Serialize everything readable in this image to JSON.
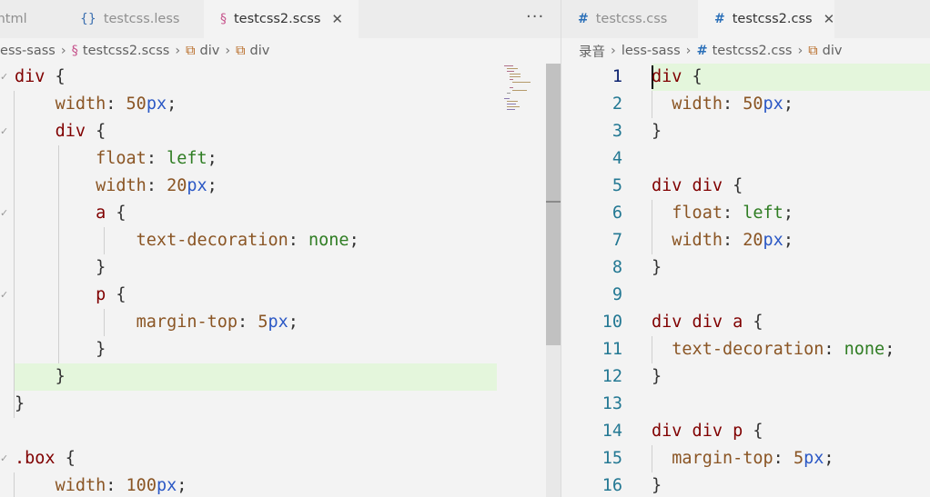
{
  "left_pane": {
    "tabs": [
      {
        "label": ".html",
        "icon": "html-file-icon"
      },
      {
        "label": "testcss.less",
        "icon": "less-file-icon"
      },
      {
        "label": "testcss2.scss",
        "icon": "sass-file-icon",
        "active": true
      }
    ],
    "more_label": "···",
    "breadcrumb": [
      "less-sass",
      "testcss2.scss",
      "div",
      "div"
    ],
    "lines": [
      "div {",
      "    width: 50px;",
      "    div {",
      "        float: left;",
      "        width: 20px;",
      "        a {",
      "            text-decoration: none;",
      "        }",
      "        p {",
      "            margin-top: 5px;",
      "        }",
      "    }",
      "}",
      "",
      ".box {",
      "    width: 100px;"
    ]
  },
  "right_pane": {
    "tabs": [
      {
        "label": "testcss.css",
        "icon": "css-hash-icon"
      },
      {
        "label": "testcss2.css",
        "icon": "css-hash-icon",
        "active": true
      }
    ],
    "breadcrumb": [
      "录音",
      "less-sass",
      "testcss2.css",
      "div"
    ],
    "line_numbers": [
      "1",
      "2",
      "3",
      "4",
      "5",
      "6",
      "7",
      "8",
      "9",
      "10",
      "11",
      "12",
      "13",
      "14",
      "15",
      "16"
    ],
    "current_line": "1",
    "lines": [
      "div {",
      "  width: 50px;",
      "}",
      "",
      "div div {",
      "  float: left;",
      "  width: 20px;",
      "}",
      "",
      "div div a {",
      "  text-decoration: none;",
      "}",
      "",
      "div div p {",
      "  margin-top: 5px;",
      "}"
    ]
  },
  "colors": {
    "selector": "#800000",
    "property": "#8a5524",
    "unit": "#2b58c5",
    "keyword_value": "#2f7d23",
    "line_number": "#237893",
    "current_line_highlight": "#e4f6dc"
  }
}
